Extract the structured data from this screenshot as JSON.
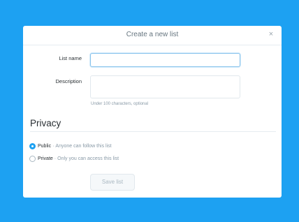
{
  "dialog": {
    "title": "Create a new list",
    "close_glyph": "×"
  },
  "form": {
    "name_label": "List name",
    "name_value": "",
    "description_label": "Description",
    "description_value": "",
    "description_hint": "Under 100 characters, optional"
  },
  "privacy": {
    "title": "Privacy",
    "options": [
      {
        "label": "Public",
        "separator": "·",
        "description": "Anyone can follow this list",
        "selected": true
      },
      {
        "label": "Private",
        "separator": "·",
        "description": "Only you can access this list",
        "selected": false
      }
    ]
  },
  "actions": {
    "save_label": "Save list",
    "save_enabled": false
  },
  "colors": {
    "background": "#1da1f2",
    "accent": "#1da1f2"
  }
}
